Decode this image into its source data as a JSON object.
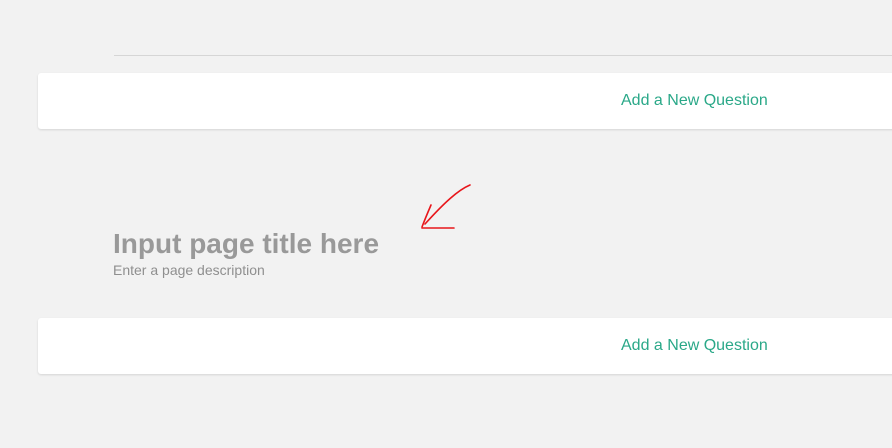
{
  "questions": {
    "add_label_top": "Add a New Question",
    "add_label_bottom": "Add a New Question"
  },
  "page": {
    "title_placeholder": "Input page title here",
    "description_placeholder": "Enter a page description"
  },
  "annotation": {
    "icon": "red-arrow-annotation-icon",
    "color": "#e8161b"
  },
  "colors": {
    "background": "#f2f2f2",
    "accent": "#2aa888",
    "placeholder_text": "#999999"
  }
}
